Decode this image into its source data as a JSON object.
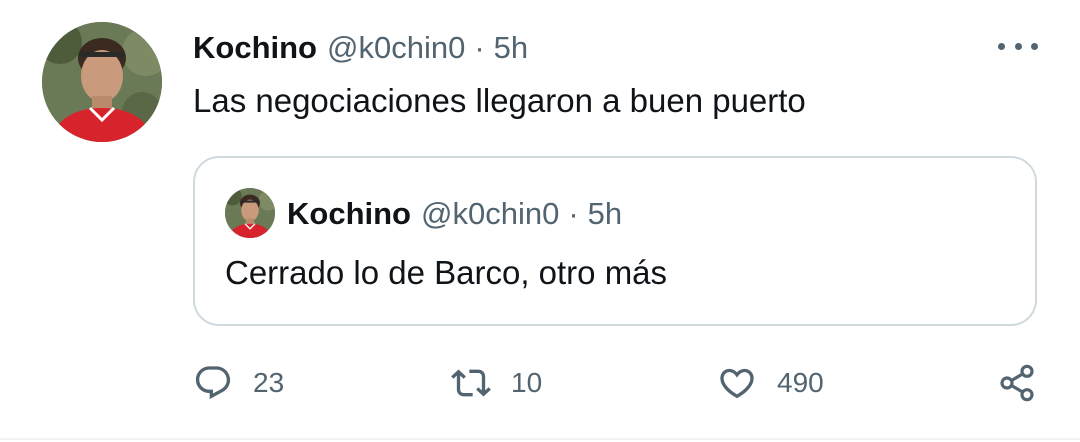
{
  "tweet": {
    "author_name": "Kochino",
    "author_handle": "@k0chin0",
    "separator": "·",
    "time": "5h",
    "text": "Las negociaciones llegaron a buen puerto"
  },
  "quoted_tweet": {
    "author_name": "Kochino",
    "author_handle": "@k0chin0",
    "separator": "·",
    "time": "5h",
    "text": "Cerrado lo de Barco, otro más"
  },
  "actions": {
    "replies": "23",
    "retweets": "10",
    "likes": "490"
  },
  "icons": {
    "more": "more-horizontal-icon",
    "reply": "reply-icon",
    "retweet": "retweet-icon",
    "like": "heart-icon",
    "share": "share-icon"
  },
  "colors": {
    "text_primary": "#0f1419",
    "text_secondary": "#536471",
    "border": "#cfd9de",
    "jersey_red": "#d7232c"
  }
}
